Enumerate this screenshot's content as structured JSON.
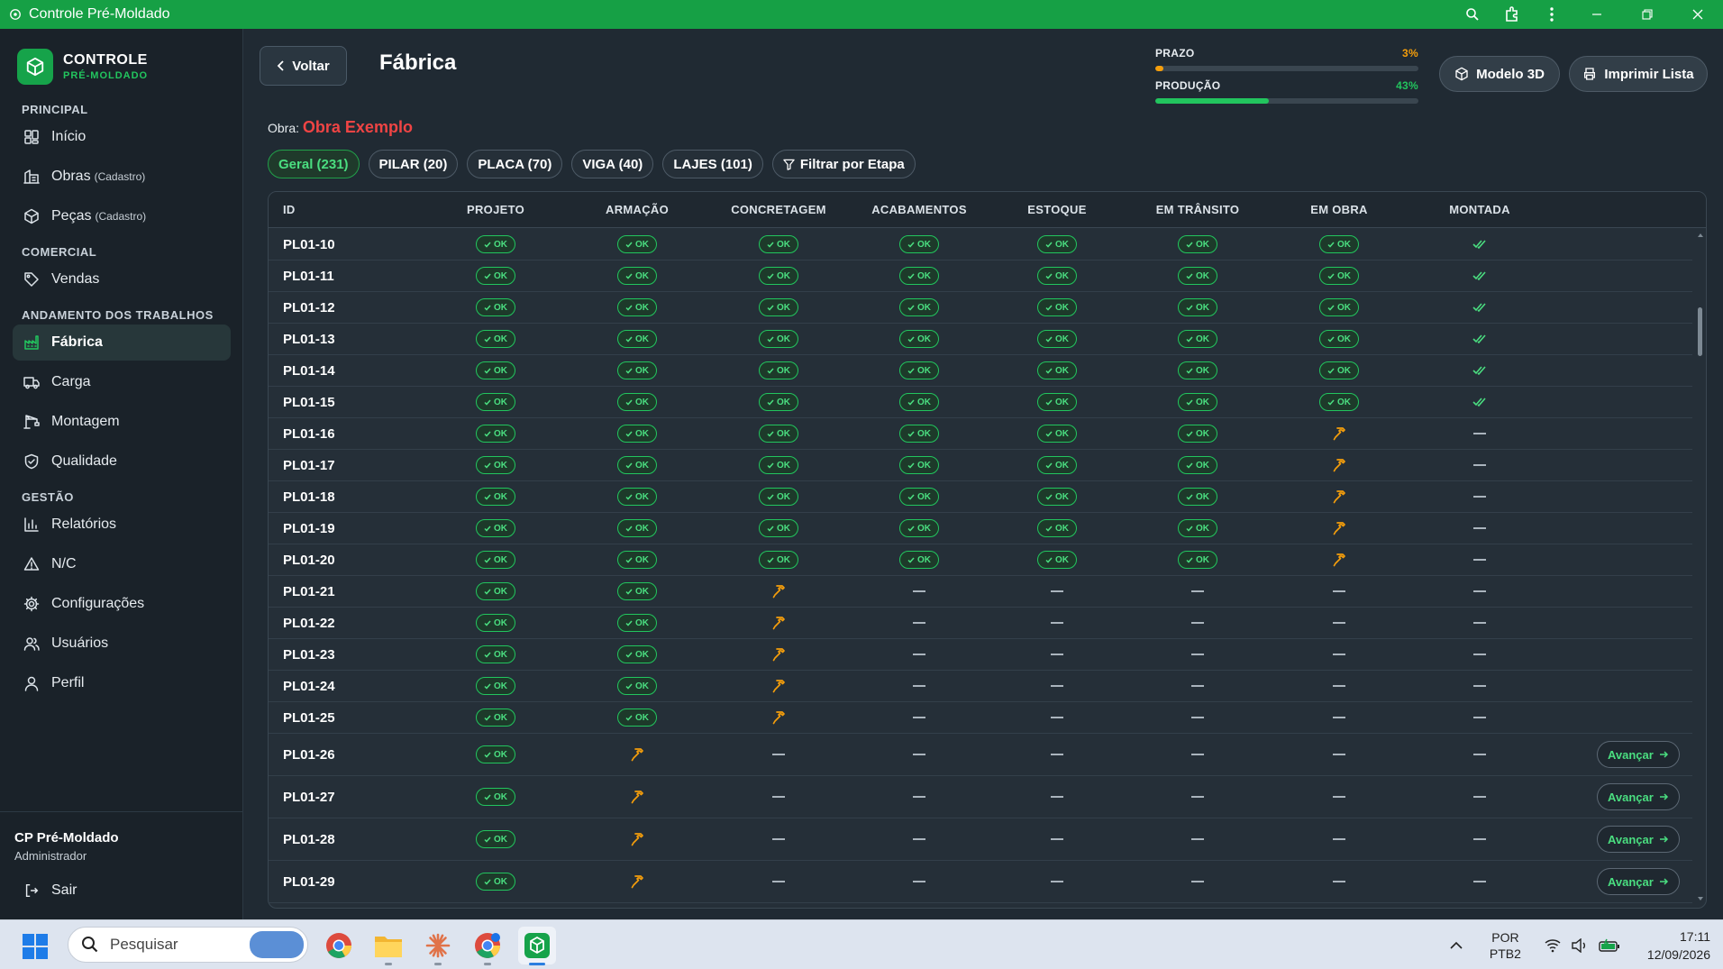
{
  "window": {
    "title": "Controle Pré-Moldado"
  },
  "sidebar": {
    "logo_main": "CONTROLE",
    "logo_sub": "PRÉ-MOLDADO",
    "sections": [
      {
        "title": "PRINCIPAL",
        "items": [
          {
            "label": "Início",
            "sub": "",
            "icon": "dashboard-grid-icon"
          },
          {
            "label": "Obras",
            "sub": "(Cadastro)",
            "icon": "building-icon"
          },
          {
            "label": "Peças",
            "sub": "(Cadastro)",
            "icon": "cube-icon"
          }
        ]
      },
      {
        "title": "COMERCIAL",
        "items": [
          {
            "label": "Vendas",
            "sub": "",
            "icon": "tag-icon"
          }
        ]
      },
      {
        "title": "ANDAMENTO DOS TRABALHOS",
        "items": [
          {
            "label": "Fábrica",
            "sub": "",
            "icon": "factory-icon",
            "active": true
          },
          {
            "label": "Carga",
            "sub": "",
            "icon": "truck-icon"
          },
          {
            "label": "Montagem",
            "sub": "",
            "icon": "crane-icon"
          },
          {
            "label": "Qualidade",
            "sub": "",
            "icon": "shield-check-icon"
          }
        ]
      },
      {
        "title": "GESTÃO",
        "items": [
          {
            "label": "Relatórios",
            "sub": "",
            "icon": "bar-chart-icon"
          },
          {
            "label": "N/C",
            "sub": "",
            "icon": "warning-icon"
          },
          {
            "label": "Configurações",
            "sub": "",
            "icon": "gear-icon"
          },
          {
            "label": "Usuários",
            "sub": "",
            "icon": "users-icon"
          },
          {
            "label": "Perfil",
            "sub": "",
            "icon": "user-icon"
          }
        ]
      }
    ],
    "footer": {
      "name": "CP Pré-Moldado",
      "role": "Administrador",
      "logout": "Sair"
    }
  },
  "header": {
    "back_label": "Voltar",
    "title": "Fábrica",
    "obra_label": "Obra:",
    "obra_name": "Obra Exemplo",
    "prazo": {
      "label": "PRAZO",
      "value_text": "3%",
      "value": 0.03,
      "color": "#f59e0b"
    },
    "producao": {
      "label": "PRODUÇÃO",
      "value_text": "43%",
      "value": 0.43,
      "color": "#22c55e"
    },
    "model_btn": "Modelo 3D",
    "print_btn": "Imprimir Lista"
  },
  "filters": [
    {
      "label": "Geral (231)",
      "active": true
    },
    {
      "label": "PILAR (20)"
    },
    {
      "label": "PLACA (70)"
    },
    {
      "label": "VIGA (40)"
    },
    {
      "label": "LAJES (101)"
    },
    {
      "label": "Filtrar por Etapa",
      "icon": "filter-icon"
    }
  ],
  "table": {
    "columns": [
      "ID",
      "PROJETO",
      "ARMAÇÃO",
      "CONCRETAGEM",
      "ACABAMENTOS",
      "ESTOQUE",
      "EM TRÂNSITO",
      "EM OBRA",
      "MONTADA"
    ],
    "ok_label": "OK",
    "advance_label": "Avançar",
    "rows": [
      {
        "id": "PL01-10",
        "s": [
          "ok",
          "ok",
          "ok",
          "ok",
          "ok",
          "ok",
          "ok",
          "done"
        ]
      },
      {
        "id": "PL01-11",
        "s": [
          "ok",
          "ok",
          "ok",
          "ok",
          "ok",
          "ok",
          "ok",
          "done"
        ]
      },
      {
        "id": "PL01-12",
        "s": [
          "ok",
          "ok",
          "ok",
          "ok",
          "ok",
          "ok",
          "ok",
          "done"
        ]
      },
      {
        "id": "PL01-13",
        "s": [
          "ok",
          "ok",
          "ok",
          "ok",
          "ok",
          "ok",
          "ok",
          "done"
        ]
      },
      {
        "id": "PL01-14",
        "s": [
          "ok",
          "ok",
          "ok",
          "ok",
          "ok",
          "ok",
          "ok",
          "done"
        ]
      },
      {
        "id": "PL01-15",
        "s": [
          "ok",
          "ok",
          "ok",
          "ok",
          "ok",
          "ok",
          "ok",
          "done"
        ]
      },
      {
        "id": "PL01-16",
        "s": [
          "ok",
          "ok",
          "ok",
          "ok",
          "ok",
          "ok",
          "work",
          "none"
        ]
      },
      {
        "id": "PL01-17",
        "s": [
          "ok",
          "ok",
          "ok",
          "ok",
          "ok",
          "ok",
          "work",
          "none"
        ]
      },
      {
        "id": "PL01-18",
        "s": [
          "ok",
          "ok",
          "ok",
          "ok",
          "ok",
          "ok",
          "work",
          "none"
        ]
      },
      {
        "id": "PL01-19",
        "s": [
          "ok",
          "ok",
          "ok",
          "ok",
          "ok",
          "ok",
          "work",
          "none"
        ]
      },
      {
        "id": "PL01-20",
        "s": [
          "ok",
          "ok",
          "ok",
          "ok",
          "ok",
          "ok",
          "work",
          "none"
        ]
      },
      {
        "id": "PL01-21",
        "s": [
          "ok",
          "ok",
          "work",
          "none",
          "none",
          "none",
          "none",
          "none"
        ]
      },
      {
        "id": "PL01-22",
        "s": [
          "ok",
          "ok",
          "work",
          "none",
          "none",
          "none",
          "none",
          "none"
        ]
      },
      {
        "id": "PL01-23",
        "s": [
          "ok",
          "ok",
          "work",
          "none",
          "none",
          "none",
          "none",
          "none"
        ]
      },
      {
        "id": "PL01-24",
        "s": [
          "ok",
          "ok",
          "work",
          "none",
          "none",
          "none",
          "none",
          "none"
        ]
      },
      {
        "id": "PL01-25",
        "s": [
          "ok",
          "ok",
          "work",
          "none",
          "none",
          "none",
          "none",
          "none"
        ]
      },
      {
        "id": "PL01-26",
        "s": [
          "ok",
          "work",
          "none",
          "none",
          "none",
          "none",
          "none",
          "none"
        ],
        "advance": true
      },
      {
        "id": "PL01-27",
        "s": [
          "ok",
          "work",
          "none",
          "none",
          "none",
          "none",
          "none",
          "none"
        ],
        "advance": true
      },
      {
        "id": "PL01-28",
        "s": [
          "ok",
          "work",
          "none",
          "none",
          "none",
          "none",
          "none",
          "none"
        ],
        "advance": true
      },
      {
        "id": "PL01-29",
        "s": [
          "ok",
          "work",
          "none",
          "none",
          "none",
          "none",
          "none",
          "none"
        ],
        "advance": true
      }
    ]
  },
  "taskbar": {
    "search_placeholder": "Pesquisar",
    "lang1": "POR",
    "lang2": "PTB2",
    "time": "17:11",
    "date": "12/09/2026"
  }
}
